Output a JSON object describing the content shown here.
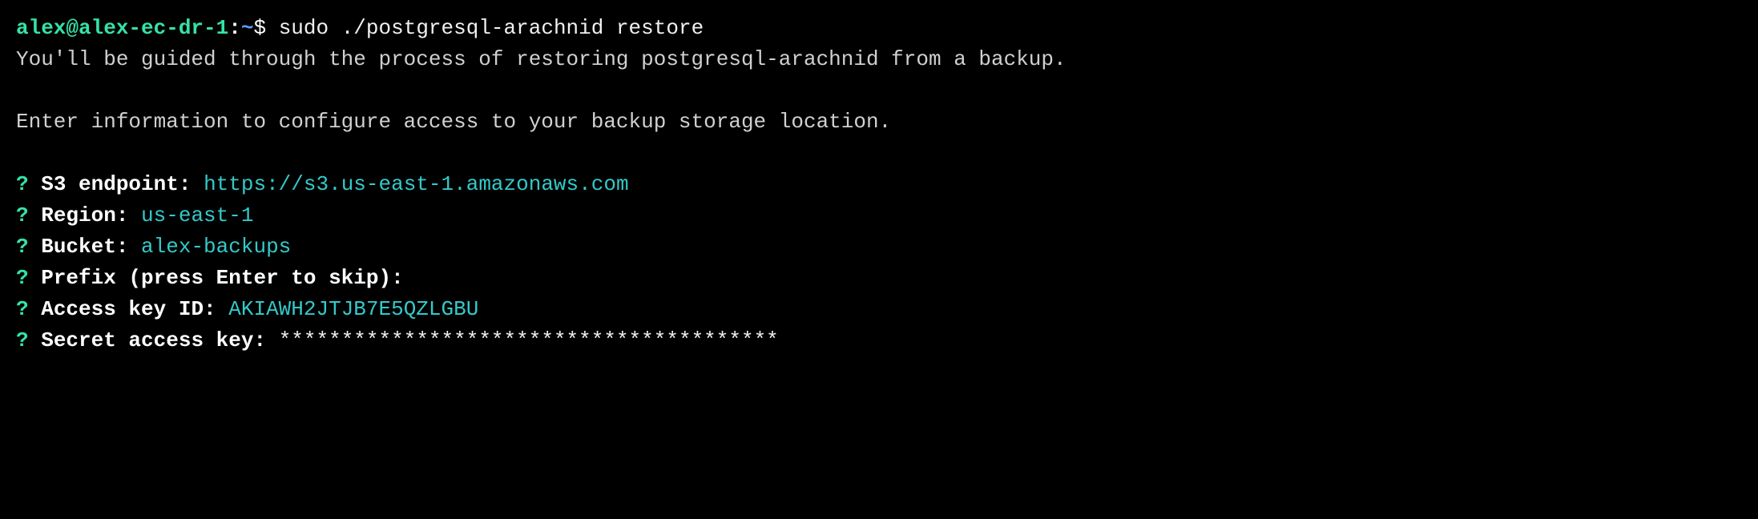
{
  "prompt": {
    "user_host": "alex@alex-ec-dr-1",
    "separator": ":",
    "path": "~",
    "symbol": "$",
    "command": "sudo ./postgresql-arachnid restore"
  },
  "intro_line": "You'll be guided through the process of restoring postgresql-arachnid from a backup.",
  "section_line": "Enter information to configure access to your backup storage location.",
  "questions": [
    {
      "marker": "?",
      "label": "S3 endpoint:",
      "value": "https://s3.us-east-1.amazonaws.com"
    },
    {
      "marker": "?",
      "label": "Region:",
      "value": "us-east-1"
    },
    {
      "marker": "?",
      "label": "Bucket:",
      "value": "alex-backups"
    },
    {
      "marker": "?",
      "label": "Prefix (press Enter to skip):",
      "value": ""
    },
    {
      "marker": "?",
      "label": "Access key ID:",
      "value": "AKIAWH2JTJB7E5QZLGBU"
    },
    {
      "marker": "?",
      "label": "Secret access key:",
      "value": "****************************************"
    }
  ]
}
